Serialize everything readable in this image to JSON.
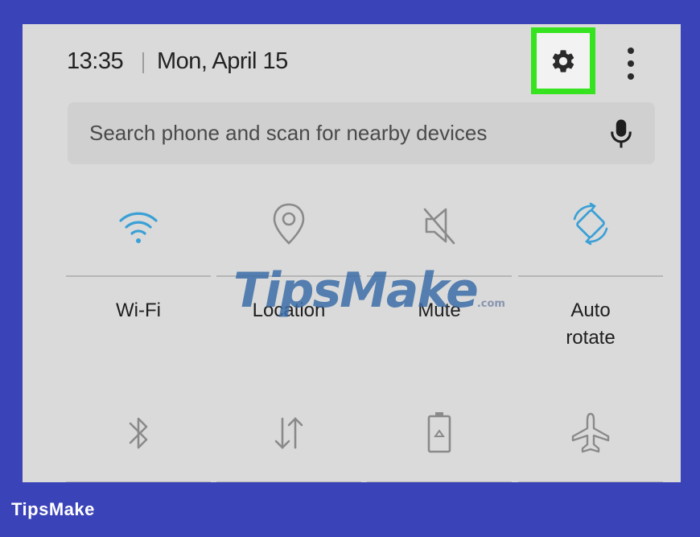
{
  "status": {
    "time": "13:35",
    "date": "Mon, April 15"
  },
  "search": {
    "placeholder": "Search phone and scan for nearby devices"
  },
  "tiles_row1": [
    {
      "label": "Wi-Fi",
      "icon": "wifi-icon",
      "active": true
    },
    {
      "label": "Location",
      "icon": "location-icon",
      "active": false
    },
    {
      "label": "Mute",
      "icon": "mute-icon",
      "active": false
    },
    {
      "label": "Auto rotate",
      "label_line1": "Auto",
      "label_line2": "rotate",
      "icon": "auto-rotate-icon",
      "active": true
    }
  ],
  "tiles_row2": [
    {
      "icon": "bluetooth-icon"
    },
    {
      "icon": "mobile-data-icon"
    },
    {
      "icon": "power-saving-icon"
    },
    {
      "icon": "airplane-icon"
    }
  ],
  "colors": {
    "accent": "#3aa0d6",
    "highlight": "#35e41e",
    "frame": "#3b43b8",
    "panel": "#dadada",
    "inactive_icon": "#8a8a8a"
  },
  "watermark": {
    "text": "TipsMake",
    "suffix": ".com"
  },
  "footer": {
    "brand": "TipsMake"
  }
}
